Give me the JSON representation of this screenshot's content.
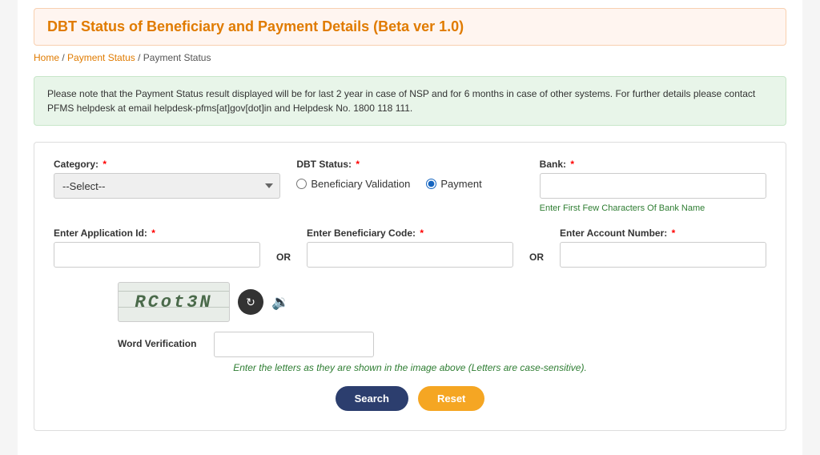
{
  "page": {
    "title": "DBT Status of Beneficiary and Payment Details (Beta ver 1.0)",
    "breadcrumb": {
      "home": "Home",
      "separator1": " / ",
      "item1": "Payment Status",
      "separator2": " / ",
      "item2": "Payment Status"
    },
    "info_message": "Please note that the Payment Status result displayed will be for last 2 year in case of NSP and for 6 months in case of other systems. For further details please contact PFMS helpdesk at email helpdesk-pfms[at]gov[dot]in and Helpdesk No. 1800 118 111.",
    "form": {
      "category_label": "Category:",
      "category_placeholder": "--Select--",
      "dbt_status_label": "DBT Status:",
      "dbt_option1": "Beneficiary Validation",
      "dbt_option2": "Payment",
      "bank_label": "Bank:",
      "bank_hint": "Enter First Few Characters Of Bank Name",
      "application_id_label": "Enter Application Id:",
      "or1": "OR",
      "beneficiary_code_label": "Enter Beneficiary Code:",
      "or2": "OR",
      "account_number_label": "Enter Account Number:",
      "captcha_text": "RCot3N",
      "word_verification_label": "Word Verification",
      "captcha_hint": "Enter the letters as they are shown in the image above (Letters are case-sensitive).",
      "search_button": "Search",
      "reset_button": "Reset"
    }
  }
}
